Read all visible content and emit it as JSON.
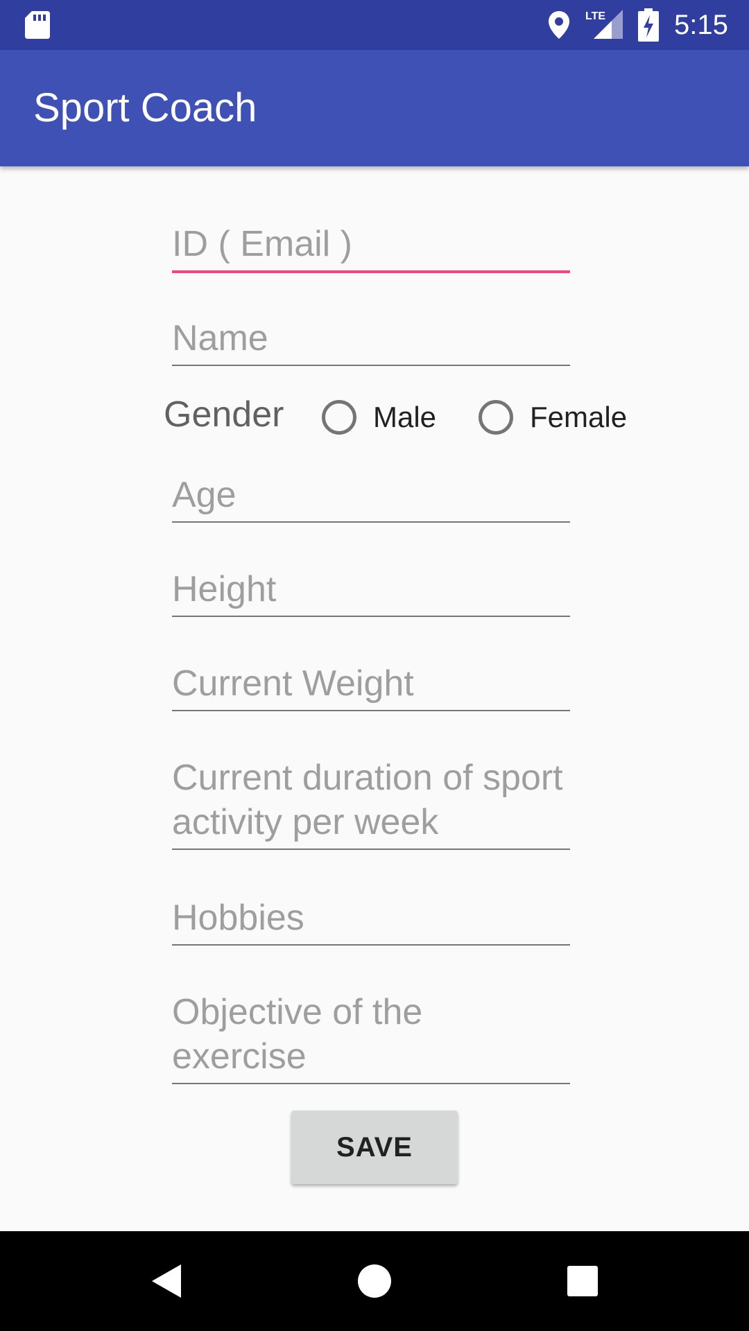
{
  "status_bar": {
    "time": "5:15",
    "network": "LTE",
    "icons": [
      "sd-card-icon",
      "location-icon",
      "lte-signal-icon",
      "battery-charging-icon"
    ]
  },
  "app_bar": {
    "title": "Sport Coach",
    "color": "#3f51b5",
    "status_color": "#303f9f"
  },
  "form": {
    "email_placeholder": "ID ( Email )",
    "name_placeholder": "Name",
    "gender_label": "Gender",
    "gender_options": [
      {
        "label": "Male",
        "checked": false
      },
      {
        "label": "Female",
        "checked": false
      }
    ],
    "age_placeholder": "Age",
    "height_placeholder": "Height",
    "weight_placeholder": "Current Weight",
    "duration_placeholder": "Current duration of sport activity per week",
    "hobbies_placeholder": "Hobbies",
    "objective_placeholder": "Objective of the exercise",
    "focus_color": "#ff4081"
  },
  "actions": {
    "save_label": "SAVE"
  },
  "nav_bar": {
    "buttons": [
      "back-icon",
      "home-icon",
      "recents-icon"
    ]
  }
}
